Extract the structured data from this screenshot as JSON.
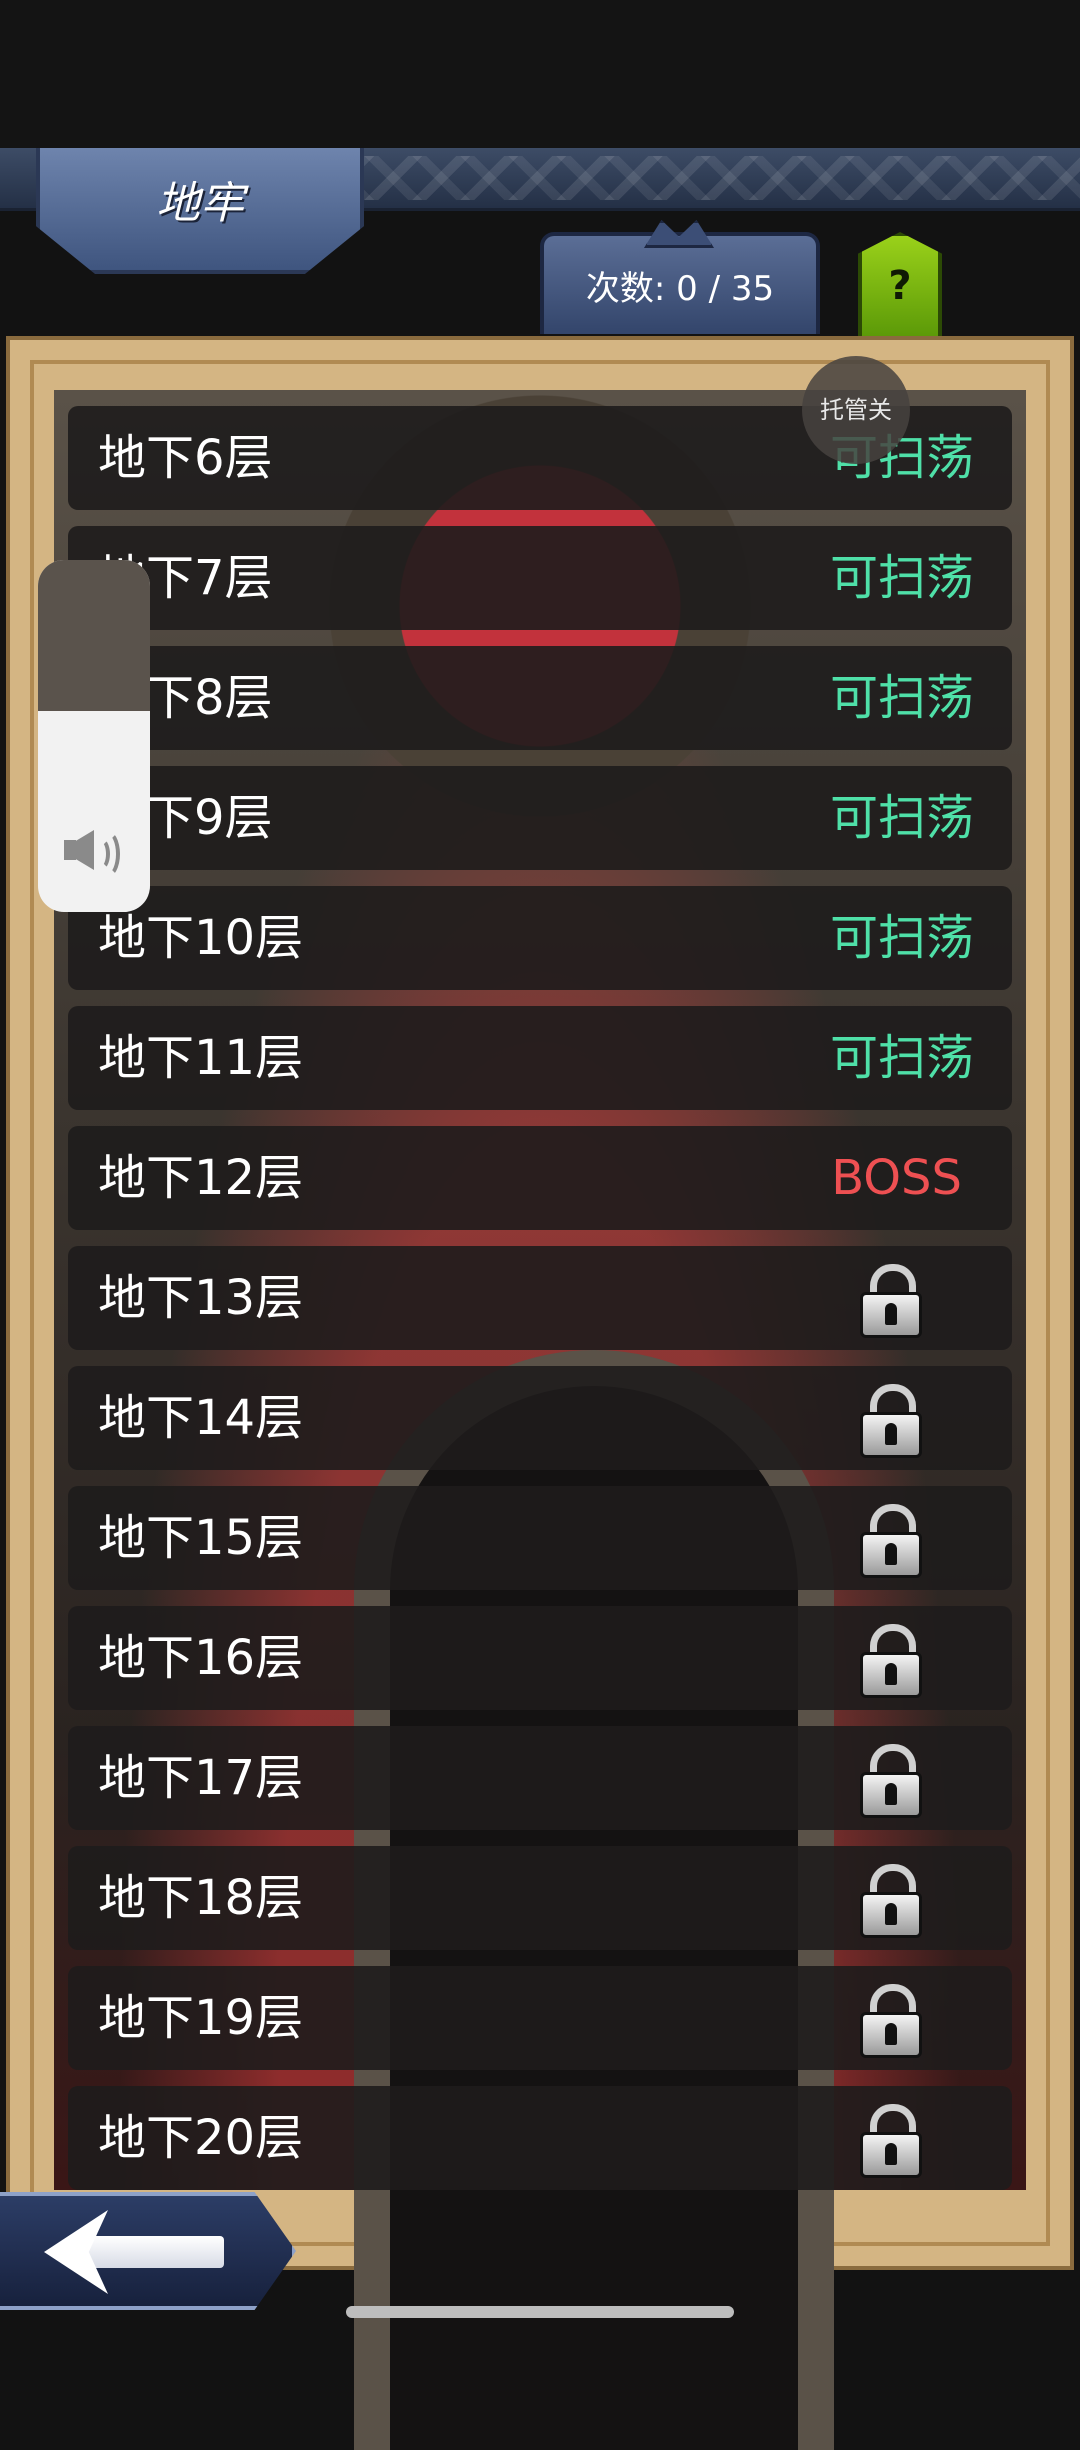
{
  "header": {
    "title": "地牢",
    "count_label": "次数: 0 / 35",
    "help_label": "?"
  },
  "trustee_label": "托管关",
  "floors": [
    {
      "label": "地下6层",
      "status": "可扫荡",
      "state": "sweep"
    },
    {
      "label": "地下7层",
      "status": "可扫荡",
      "state": "sweep"
    },
    {
      "label": "地下8层",
      "status": "可扫荡",
      "state": "sweep"
    },
    {
      "label": "地下9层",
      "status": "可扫荡",
      "state": "sweep"
    },
    {
      "label": "地下10层",
      "status": "可扫荡",
      "state": "sweep"
    },
    {
      "label": "地下11层",
      "status": "可扫荡",
      "state": "sweep"
    },
    {
      "label": "地下12层",
      "status": "BOSS",
      "state": "boss"
    },
    {
      "label": "地下13层",
      "state": "locked",
      "icon": "lock-icon"
    },
    {
      "label": "地下14层",
      "state": "locked",
      "icon": "lock-icon"
    },
    {
      "label": "地下15层",
      "state": "locked",
      "icon": "lock-icon"
    },
    {
      "label": "地下16层",
      "state": "locked",
      "icon": "lock-icon"
    },
    {
      "label": "地下17层",
      "state": "locked",
      "icon": "lock-icon"
    },
    {
      "label": "地下18层",
      "state": "locked",
      "icon": "lock-icon"
    },
    {
      "label": "地下19层",
      "state": "locked",
      "icon": "lock-icon"
    },
    {
      "label": "地下20层",
      "state": "locked",
      "icon": "lock-icon"
    }
  ],
  "volume": {
    "level": 0.57,
    "icon": "speaker-icon"
  },
  "colors": {
    "sweep": "#4fe0a8",
    "boss": "#ee5052",
    "help": "#8cc412"
  }
}
